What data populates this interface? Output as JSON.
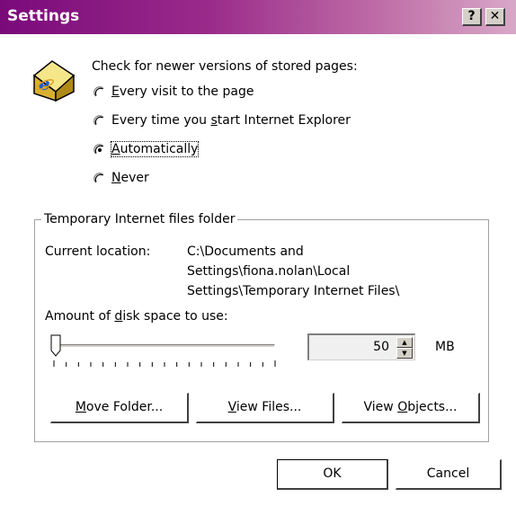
{
  "window": {
    "title": "Settings",
    "help_label": "?",
    "close_label": "✕"
  },
  "check": {
    "heading": "Check for newer versions of stored pages:",
    "options": [
      {
        "pre": "",
        "accel": "E",
        "post": "very visit to the page",
        "selected": false
      },
      {
        "pre": "Every time you ",
        "accel": "s",
        "post": "tart Internet Explorer",
        "selected": false
      },
      {
        "pre": "",
        "accel": "A",
        "post": "utomatically",
        "selected": true
      },
      {
        "pre": "",
        "accel": "N",
        "post": "ever",
        "selected": false
      }
    ]
  },
  "temp_folder": {
    "legend": "Temporary Internet files folder",
    "location_label": "Current location:",
    "location_lines": [
      "C:\\Documents and",
      "Settings\\fiona.nolan\\Local",
      "Settings\\Temporary Internet Files\\"
    ],
    "disk_label_pre": "Amount of ",
    "disk_label_accel": "d",
    "disk_label_post": "isk space to use:",
    "disk_value": "50",
    "disk_unit": "MB",
    "slider_fraction": 0.0
  },
  "buttons": {
    "move_accel": "M",
    "move_rest": "ove Folder...",
    "view_files_accel": "V",
    "view_files_rest": "iew Files...",
    "view_objects_pre": "View ",
    "view_objects_accel": "O",
    "view_objects_rest": "bjects...",
    "ok": "OK",
    "cancel": "Cancel"
  },
  "colors": {
    "title_start": "#7a0a7a",
    "title_end": "#d8a8c8",
    "face": "#d4d0c8"
  },
  "icons": {
    "app": "internet-explorer-folder-icon"
  }
}
